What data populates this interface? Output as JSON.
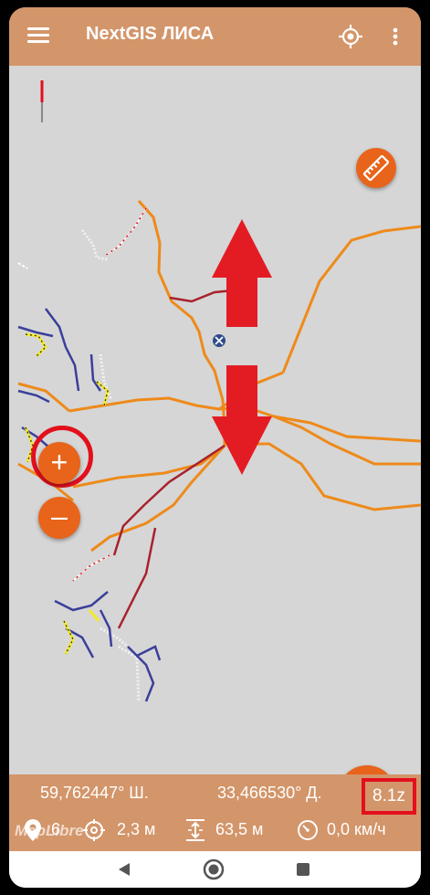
{
  "app": {
    "title": "NextGIS ЛИСА",
    "menu_icon": "hamburger-menu-icon",
    "locate_icon": "crosshair-locate-icon",
    "more_icon": "more-vert-icon"
  },
  "map": {
    "attribution": "MapLibre",
    "ruler_icon": "ruler-icon",
    "zoom_in_label": "+",
    "zoom_out_label": "–",
    "add_label": "+"
  },
  "status": {
    "latitude": "59,762447° Ш.",
    "longitude": "33,466530° Д.",
    "zoom": "8.1z",
    "satellites": "6",
    "accuracy": "2,3 м",
    "altitude": "63,5 м",
    "speed": "0,0 км/ч"
  },
  "colors": {
    "app_bar": "#d3956a",
    "accent": "#e8641b",
    "highlight": "#e3101c",
    "map_background": "#d6d6d6"
  }
}
